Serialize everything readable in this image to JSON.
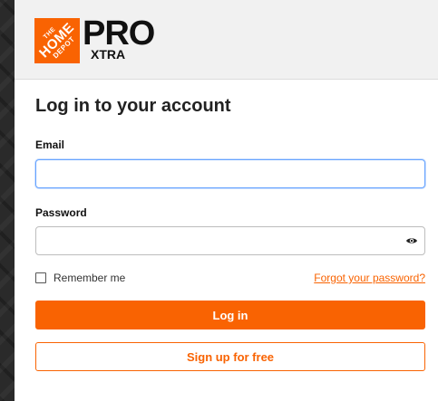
{
  "brand": {
    "logo_line1": "THE",
    "logo_line2": "HOME",
    "logo_line3": "DEPOT",
    "pro": "PRO",
    "xtra": "XTRA",
    "accent_color": "#f96302"
  },
  "form": {
    "title": "Log in to your account",
    "email_label": "Email",
    "email_value": "",
    "password_label": "Password",
    "password_value": "",
    "password_toggle_icon": "eye-icon",
    "remember_label": "Remember me",
    "remember_checked": false,
    "forgot_link": "Forgot your password?",
    "login_button": "Log in",
    "signup_button": "Sign up for free"
  }
}
